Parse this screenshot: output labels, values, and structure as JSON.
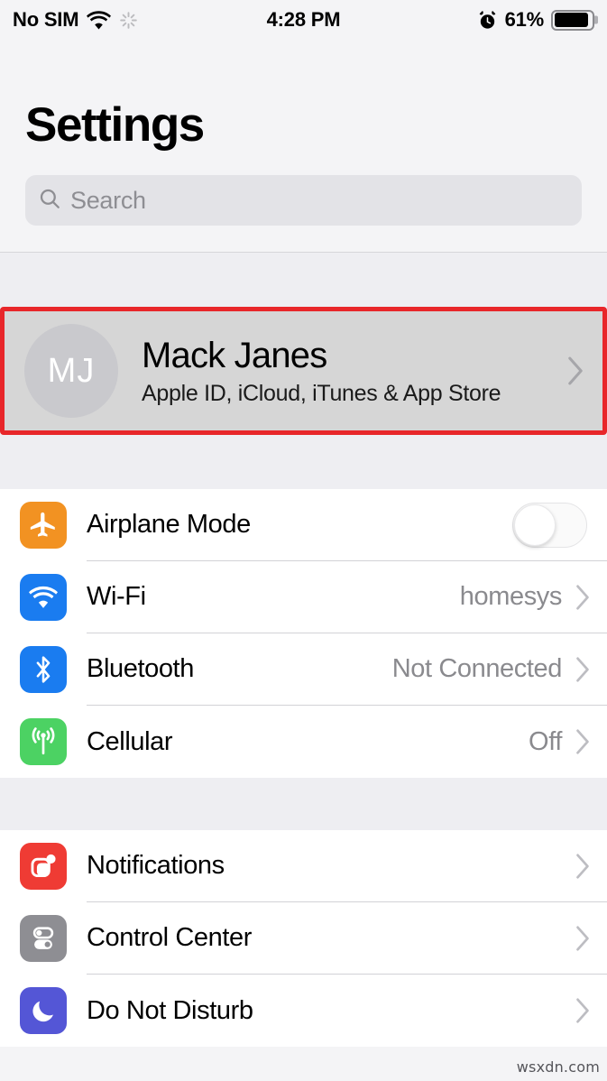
{
  "status_bar": {
    "carrier": "No SIM",
    "wifi_icon": "wifi-icon",
    "activity_icon": "activity-spinner-icon",
    "time": "4:28 PM",
    "alarm_icon": "alarm-clock-icon",
    "battery_percent": "61%",
    "battery_icon": "battery-icon"
  },
  "header": {
    "title": "Settings",
    "search": {
      "icon": "search-icon",
      "placeholder": "Search",
      "value": ""
    }
  },
  "apple_id": {
    "avatar_initials": "MJ",
    "name": "Mack Janes",
    "subtitle": "Apple ID, iCloud, iTunes & App Store",
    "chevron": "chevron-right-icon",
    "highlight_color": "#e8262a",
    "highlighted": true
  },
  "groups": [
    {
      "rows": [
        {
          "name": "airplane-mode",
          "label": "Airplane Mode",
          "icon": "airplane-icon",
          "icon_color": "#f29222",
          "accessory": "toggle",
          "toggle_on": false,
          "value": ""
        },
        {
          "name": "wifi",
          "label": "Wi-Fi",
          "icon": "wifi-icon",
          "icon_color": "#1a7cf0",
          "accessory": "chevron",
          "value": "homesys"
        },
        {
          "name": "bluetooth",
          "label": "Bluetooth",
          "icon": "bluetooth-icon",
          "icon_color": "#1a7cf0",
          "accessory": "chevron",
          "value": "Not Connected"
        },
        {
          "name": "cellular",
          "label": "Cellular",
          "icon": "cellular-antenna-icon",
          "icon_color": "#4cd263",
          "accessory": "chevron",
          "value": "Off"
        }
      ]
    },
    {
      "rows": [
        {
          "name": "notifications",
          "label": "Notifications",
          "icon": "notifications-icon",
          "icon_color": "#ef3b34",
          "accessory": "chevron",
          "value": ""
        },
        {
          "name": "control-center",
          "label": "Control Center",
          "icon": "control-center-icon",
          "icon_color": "#8e8e93",
          "accessory": "chevron",
          "value": ""
        },
        {
          "name": "do-not-disturb",
          "label": "Do Not Disturb",
          "icon": "moon-icon",
          "icon_color": "#5456d6",
          "accessory": "chevron",
          "value": ""
        }
      ]
    }
  ],
  "watermark": "wsxdn.com"
}
